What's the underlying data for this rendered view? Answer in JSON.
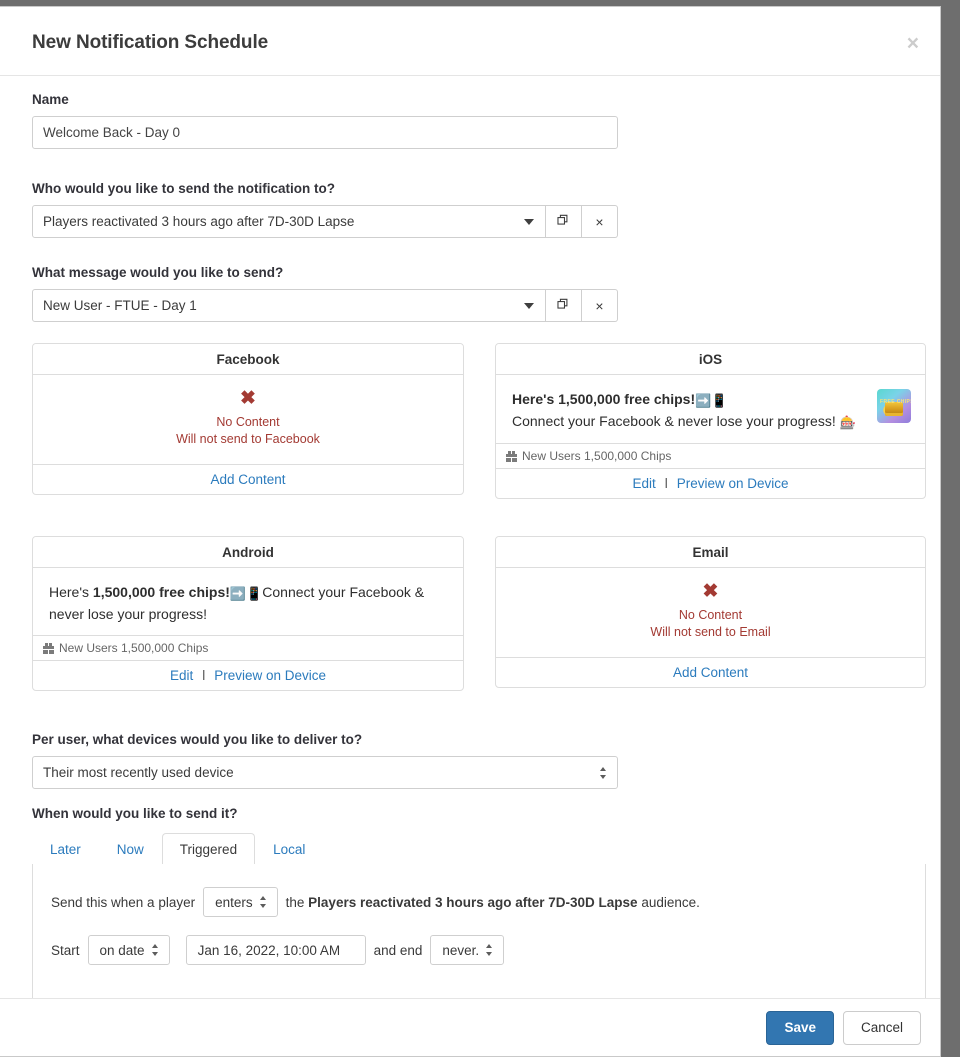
{
  "modal": {
    "title": "New Notification Schedule",
    "close_icon": "close-icon"
  },
  "fields": {
    "name_label": "Name",
    "name_value": "Welcome Back - Day 0",
    "audience_label": "Who would you like to send the notification to?",
    "audience_value": "Players reactivated 3 hours ago after 7D-30D Lapse",
    "message_label": "What message would you like to send?",
    "message_value": "New User - FTUE - Day 1",
    "devices_label": "Per user, what devices would you like to deliver to?",
    "devices_value": "Their most recently used device",
    "when_label": "When would you like to send it?"
  },
  "combo_buttons": {
    "copy_icon": "copy-icon",
    "clear_label": "×"
  },
  "cards": {
    "facebook": {
      "title": "Facebook",
      "state": "empty",
      "x_mark": "✖",
      "empty_title": "No Content",
      "empty_sub": "Will not send to Facebook",
      "action": "Add Content"
    },
    "ios": {
      "title": "iOS",
      "state": "filled",
      "line1_text": "Here's 1,500,000 free chips!",
      "line1_emoji": "➡️📱",
      "line2_text": "Connect your Facebook & never lose your progress!",
      "line2_emoji": "🎰",
      "meta": "New Users 1,500,000 Chips",
      "edit": "Edit",
      "separator": "l",
      "preview": "Preview on Device",
      "thumb_caption": "FREE CHIPS"
    },
    "android": {
      "title": "Android",
      "state": "filled",
      "prefix": "Here's ",
      "bold": "1,500,000 free chips!",
      "emoji": "➡️📱",
      "suffix": "Connect your Facebook & never lose your progress!",
      "meta": "New Users 1,500,000 Chips",
      "edit": "Edit",
      "separator": "l",
      "preview": "Preview on Device"
    },
    "email": {
      "title": "Email",
      "state": "empty",
      "x_mark": "✖",
      "empty_title": "No Content",
      "empty_sub": "Will not send to Email",
      "action": "Add Content"
    }
  },
  "tabs": [
    {
      "label": "Later",
      "active": false
    },
    {
      "label": "Now",
      "active": false
    },
    {
      "label": "Triggered",
      "active": true
    },
    {
      "label": "Local",
      "active": false
    }
  ],
  "trigger": {
    "lead_text": "Send this when a player",
    "event_value": "enters",
    "mid_text": "the",
    "audience_name": "Players reactivated 3 hours ago after 7D-30D Lapse",
    "tail_text": "audience.",
    "start_label": "Start",
    "start_mode": "on date",
    "start_date": "Jan 16, 2022, 10:00 AM",
    "end_label": "and end",
    "end_value": "never."
  },
  "footer": {
    "save_label": "Save",
    "cancel_label": "Cancel"
  },
  "colors": {
    "link": "#2b7bbd",
    "danger": "#a33a33",
    "primary": "#3276b1",
    "backdrop": "#6e6e6e"
  }
}
